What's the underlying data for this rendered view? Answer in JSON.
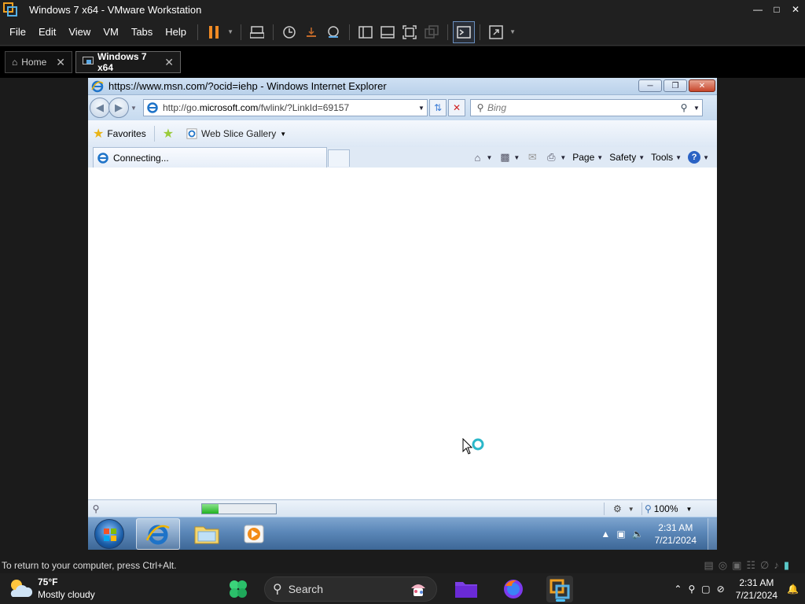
{
  "vmware": {
    "window_title": "Windows 7 x64 - VMware Workstation",
    "menu": [
      "File",
      "Edit",
      "View",
      "VM",
      "Tabs",
      "Help"
    ],
    "tabs": [
      {
        "label": "Home"
      },
      {
        "label": "Windows 7 x64"
      }
    ],
    "status_text": "To return to your computer, press Ctrl+Alt."
  },
  "ie": {
    "window_title": "https://www.msn.com/?ocid=iehp - Windows Internet Explorer",
    "address_prefix": "http://go.",
    "address_domain": "microsoft.com",
    "address_suffix": "/fwlink/?LinkId=69157",
    "search_placeholder": "Bing",
    "favorites_label": "Favorites",
    "web_slice_label": "Web Slice Gallery",
    "tab_label": "Connecting...",
    "commands": {
      "page": "Page",
      "safety": "Safety",
      "tools": "Tools"
    },
    "zoom": "100%",
    "progress": 0.22
  },
  "guest_taskbar": {
    "time": "2:31 AM",
    "date": "7/21/2024"
  },
  "host_taskbar": {
    "weather_temp": "75°F",
    "weather_desc": "Mostly cloudy",
    "search_label": "Search",
    "time": "2:31 AM",
    "date": "7/21/2024"
  },
  "colors": {
    "accent": "#4cc2ff",
    "pause": "#f08a24",
    "progress": "#22b322"
  }
}
